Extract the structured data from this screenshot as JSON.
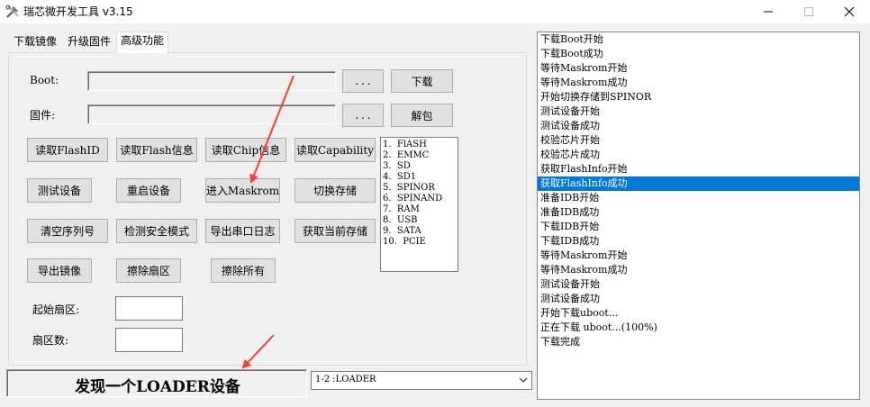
{
  "window": {
    "title": "瑞芯微开发工具 v3.15",
    "app_icon": "tools-icon",
    "controls": [
      "minimize-icon",
      "maximize-icon",
      "close-icon"
    ]
  },
  "tabs": [
    {
      "label": "下载镜像",
      "active": false
    },
    {
      "label": "升级固件",
      "active": false
    },
    {
      "label": "高级功能",
      "active": true
    }
  ],
  "advanced": {
    "boot_label": "Boot:",
    "boot_value": "",
    "boot_browse": "...",
    "download_button": "下载",
    "firmware_label": "固件:",
    "firmware_value": "",
    "firmware_browse": "...",
    "unpack_button": "解包",
    "buttons": {
      "read_flash_id": "读取FlashID",
      "read_flash_info": "读取Flash信息",
      "read_chip_info": "读取Chip信息",
      "read_capability": "读取Capability",
      "test_device": "测试设备",
      "reset_device": "重启设备",
      "enter_maskrom": "进入Maskrom",
      "switch_storage": "切换存储",
      "clear_serial": "清空序列号",
      "check_secure_mode": "检测安全模式",
      "export_serial_log": "导出串口日志",
      "get_current_storage": "获取当前存储",
      "export_image": "导出镜像",
      "erase_sector": "擦除扇区",
      "erase_all": "擦除所有"
    },
    "storage_list": [
      "1.  FlASH",
      "2.  EMMC",
      "3.  SD",
      "4.  SD1",
      "5.  SPINOR",
      "6.  SPINAND",
      "7.  RAM",
      "8.  USB",
      "9.  SATA",
      "10.  PCIE"
    ],
    "start_sector_label": "起始扇区:",
    "start_sector_value": "",
    "sector_count_label": "扇区数:",
    "sector_count_value": ""
  },
  "status": {
    "message": "发现一个LOADER设备",
    "device_select": "1-2 :LOADER"
  },
  "log": {
    "selected_index": 10,
    "lines": [
      "下载Boot开始",
      "下载Boot成功",
      "等待Maskrom开始",
      "等待Maskrom成功",
      "开始切换存储到SPINOR",
      "测试设备开始",
      "测试设备成功",
      "校验芯片开始",
      "校验芯片成功",
      "获取FlashInfo开始",
      "获取FlashInfo成功",
      "准备IDB开始",
      "准备IDB成功",
      "下载IDB开始",
      "下载IDB成功",
      "等待Maskrom开始",
      "等待Maskrom成功",
      "测试设备开始",
      "测试设备成功",
      "开始下载uboot...",
      "正在下载 uboot...(100%)",
      "下载完成"
    ]
  },
  "colors": {
    "selection": "#0078d7",
    "annotation_arrow": "#ff3b2f",
    "window_bg": "#f0f0f0"
  }
}
